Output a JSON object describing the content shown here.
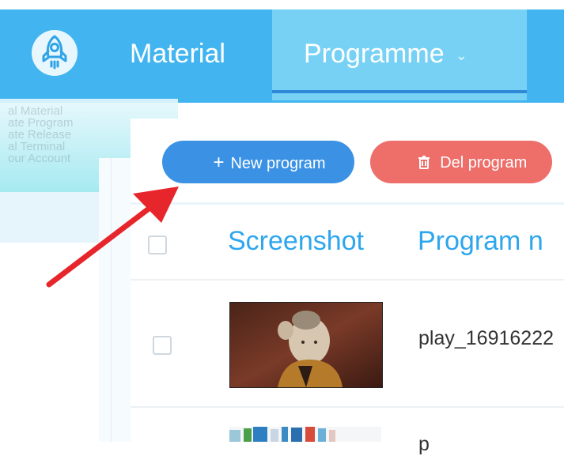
{
  "nav": {
    "items": [
      {
        "label": "Material"
      },
      {
        "label": "Programme",
        "has_dropdown": true,
        "active": true
      }
    ],
    "chevron": "⌄"
  },
  "ghost_menu": {
    "lines": [
      "al Material",
      "ate Program",
      "ate Release",
      "al Terminal",
      "our Account"
    ]
  },
  "toolbar": {
    "new_icon": "+",
    "new_label": "New program",
    "del_icon": "🗑",
    "del_label": "Del program"
  },
  "table": {
    "columns": [
      "Screenshot",
      "Program n"
    ],
    "rows": [
      {
        "name": "play_16916222",
        "checked": false
      },
      {
        "name": "p",
        "checked": false
      }
    ]
  },
  "colors": {
    "nav_bg": "#42b5f0",
    "nav_active_bg": "#77d1f5",
    "primary_button": "#3b92e4",
    "danger_button": "#ee6e6a",
    "header_text": "#2da6ee",
    "annotation_arrow": "#e6262b"
  },
  "icons": {
    "logo": "rocket-icon",
    "new": "plus-icon",
    "delete": "trash-icon",
    "dropdown": "chevron-down-icon"
  }
}
